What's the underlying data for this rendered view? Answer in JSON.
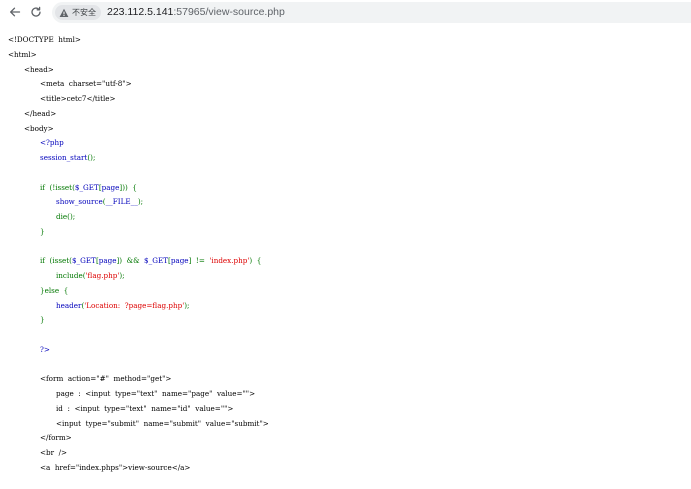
{
  "browser": {
    "security_label": "不安全",
    "url_host": "223.112.5.141",
    "url_rest": ":57965/view-source.php",
    "icons": {
      "back": "back-arrow-icon",
      "reload": "reload-icon",
      "security": "warning-triangle-icon"
    }
  },
  "colors": {
    "html": "#000000",
    "php_default": "#0000bb",
    "keyword": "#007700",
    "string": "#dd0000"
  },
  "source": {
    "lines": [
      {
        "indent": 0,
        "tokens": [
          {
            "t": "<!DOCTYPE  html>",
            "c": "html"
          }
        ]
      },
      {
        "indent": 0,
        "tokens": [
          {
            "t": "<html>",
            "c": "html"
          }
        ]
      },
      {
        "indent": 1,
        "tokens": [
          {
            "t": "<head>",
            "c": "html"
          }
        ]
      },
      {
        "indent": 2,
        "tokens": [
          {
            "t": "<meta  charset=\"utf-8\">",
            "c": "html"
          }
        ]
      },
      {
        "indent": 2,
        "tokens": [
          {
            "t": "<title>cetc7</title>",
            "c": "html"
          }
        ]
      },
      {
        "indent": 1,
        "tokens": [
          {
            "t": "</head>",
            "c": "html"
          }
        ]
      },
      {
        "indent": 1,
        "tokens": [
          {
            "t": "<body>",
            "c": "html"
          }
        ]
      },
      {
        "indent": 2,
        "tokens": [
          {
            "t": "<?php",
            "c": "php"
          }
        ]
      },
      {
        "indent": 2,
        "tokens": [
          {
            "t": "session_start",
            "c": "php"
          },
          {
            "t": "();",
            "c": "kw"
          }
        ]
      },
      {
        "indent": 0,
        "tokens": []
      },
      {
        "indent": 2,
        "tokens": [
          {
            "t": "if  (!",
            "c": "kw"
          },
          {
            "t": "isset",
            "c": "kw"
          },
          {
            "t": "(",
            "c": "kw"
          },
          {
            "t": "$_GET",
            "c": "php"
          },
          {
            "t": "[",
            "c": "kw"
          },
          {
            "t": "page",
            "c": "php"
          },
          {
            "t": "]))  {",
            "c": "kw"
          }
        ]
      },
      {
        "indent": 3,
        "tokens": [
          {
            "t": "show_source",
            "c": "php"
          },
          {
            "t": "(",
            "c": "kw"
          },
          {
            "t": "__FILE__",
            "c": "php"
          },
          {
            "t": ");",
            "c": "kw"
          }
        ]
      },
      {
        "indent": 3,
        "tokens": [
          {
            "t": "die",
            "c": "kw"
          },
          {
            "t": "();",
            "c": "kw"
          }
        ]
      },
      {
        "indent": 2,
        "tokens": [
          {
            "t": "}",
            "c": "kw"
          }
        ]
      },
      {
        "indent": 0,
        "tokens": []
      },
      {
        "indent": 2,
        "tokens": [
          {
            "t": "if  (",
            "c": "kw"
          },
          {
            "t": "isset",
            "c": "kw"
          },
          {
            "t": "(",
            "c": "kw"
          },
          {
            "t": "$_GET",
            "c": "php"
          },
          {
            "t": "[",
            "c": "kw"
          },
          {
            "t": "page",
            "c": "php"
          },
          {
            "t": "])  &&  ",
            "c": "kw"
          },
          {
            "t": "$_GET",
            "c": "php"
          },
          {
            "t": "[",
            "c": "kw"
          },
          {
            "t": "page",
            "c": "php"
          },
          {
            "t": "]  !=  ",
            "c": "kw"
          },
          {
            "t": "'index.php'",
            "c": "str"
          },
          {
            "t": ")  {",
            "c": "kw"
          }
        ]
      },
      {
        "indent": 3,
        "tokens": [
          {
            "t": "include",
            "c": "kw"
          },
          {
            "t": "(",
            "c": "kw"
          },
          {
            "t": "'flag.php'",
            "c": "str"
          },
          {
            "t": ");",
            "c": "kw"
          }
        ]
      },
      {
        "indent": 2,
        "tokens": [
          {
            "t": "}else  {",
            "c": "kw"
          }
        ]
      },
      {
        "indent": 3,
        "tokens": [
          {
            "t": "header",
            "c": "php"
          },
          {
            "t": "(",
            "c": "kw"
          },
          {
            "t": "'Location:  ?page=flag.php'",
            "c": "str"
          },
          {
            "t": ");",
            "c": "kw"
          }
        ]
      },
      {
        "indent": 2,
        "tokens": [
          {
            "t": "}",
            "c": "kw"
          }
        ]
      },
      {
        "indent": 0,
        "tokens": []
      },
      {
        "indent": 2,
        "tokens": [
          {
            "t": "?>",
            "c": "php"
          }
        ]
      },
      {
        "indent": 0,
        "tokens": []
      },
      {
        "indent": 2,
        "tokens": [
          {
            "t": "<form  action=\"#\"  method=\"get\">",
            "c": "html"
          }
        ]
      },
      {
        "indent": 3,
        "tokens": [
          {
            "t": "page  :  <input  type=\"text\"  name=\"page\"  value=\"\">",
            "c": "html"
          }
        ]
      },
      {
        "indent": 3,
        "tokens": [
          {
            "t": "id  :  <input  type=\"text\"  name=\"id\"  value=\"\">",
            "c": "html"
          }
        ]
      },
      {
        "indent": 3,
        "tokens": [
          {
            "t": "<input  type=\"submit\"  name=\"submit\"  value=\"submit\">",
            "c": "html"
          }
        ]
      },
      {
        "indent": 2,
        "tokens": [
          {
            "t": "</form>",
            "c": "html"
          }
        ]
      },
      {
        "indent": 2,
        "tokens": [
          {
            "t": "<br  />",
            "c": "html"
          }
        ]
      },
      {
        "indent": 2,
        "tokens": [
          {
            "t": "<a  href=\"index.phps\">view-source</a>",
            "c": "html"
          }
        ]
      }
    ]
  }
}
